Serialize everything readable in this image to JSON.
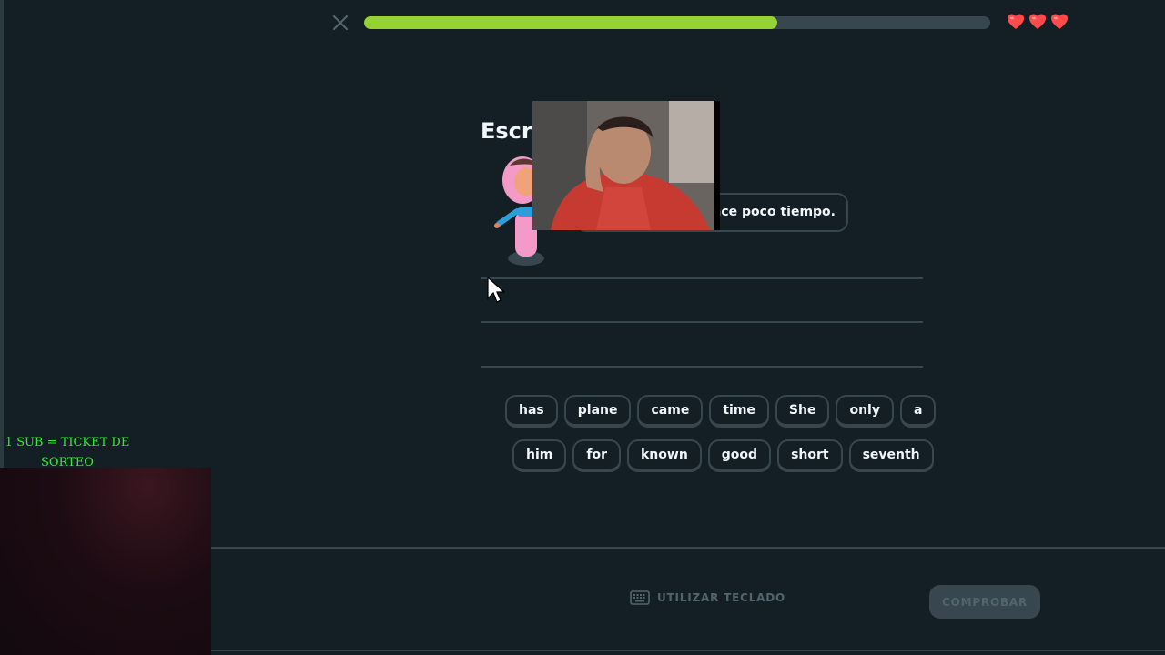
{
  "header": {
    "close_icon": "close-icon",
    "progress_fraction": 0.66,
    "hearts_count": 3,
    "colors": {
      "progress": "#93d333",
      "heart": "#ff4b4b"
    }
  },
  "exercise": {
    "title": "Escri",
    "bubble_text": "hace poco tiempo."
  },
  "word_bank": {
    "row1": [
      "has",
      "plane",
      "came",
      "time",
      "She",
      "only",
      "a"
    ],
    "row2": [
      "him",
      "for",
      "known",
      "good",
      "short",
      "seventh"
    ]
  },
  "footer": {
    "keyboard_label": "UTILIZAR TECLADO",
    "check_label": "COMPROBAR"
  },
  "overlay": {
    "sub_line1": "1 SUB = TICKET DE",
    "sub_line2": "SORTEO"
  }
}
